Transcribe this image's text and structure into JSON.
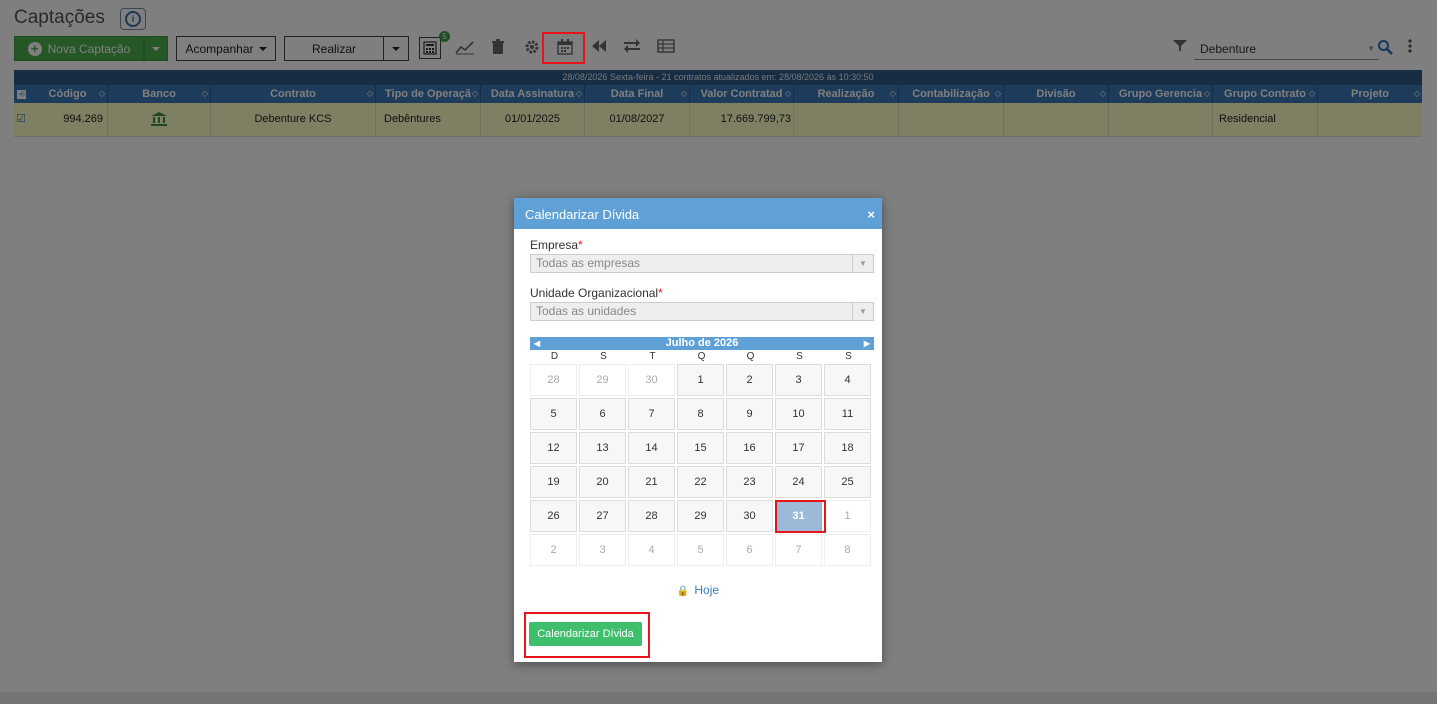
{
  "page": {
    "title": "Captações"
  },
  "toolbar": {
    "new_label": "Nova Captação",
    "follow_label": "Acompanhar",
    "realize_label": "Realizar",
    "calc_badge": "5",
    "filter_value": "Debenture"
  },
  "grid": {
    "status_line": "28/08/2026 Sexta-feira - 21 contratos atualizados em: 28/08/2026 às 10:30:50",
    "columns": [
      "Código",
      "Banco",
      "Contrato",
      "Tipo de Operaçã",
      "Data Assinatura",
      "Data Final",
      "Valor Contratad",
      "Realização",
      "Contabilização",
      "Divisão",
      "Grupo Gerencia",
      "Grupo Contrato",
      "Projeto"
    ],
    "row": {
      "codigo": "994.269",
      "contrato": "Debenture KCS",
      "tipo": "Debêntures",
      "assinatura": "01/01/2025",
      "final": "01/08/2027",
      "valor": "17.669.799,73",
      "grupo_contrato": "Residencial"
    }
  },
  "modal": {
    "title": "Calendarizar Dívida",
    "close": "×",
    "empresa_label": "Empresa",
    "empresa_value": "Todas as empresas",
    "unidade_label": "Unidade Organizacional",
    "unidade_value": "Todas as unidades",
    "required_mark": "*",
    "calendar": {
      "month_label": "Julho de 2026",
      "weekdays": [
        "D",
        "S",
        "T",
        "Q",
        "Q",
        "S",
        "S"
      ],
      "weeks": [
        [
          "28",
          "29",
          "30",
          "1",
          "2",
          "3",
          "4"
        ],
        [
          "5",
          "6",
          "7",
          "8",
          "9",
          "10",
          "11"
        ],
        [
          "12",
          "13",
          "14",
          "15",
          "16",
          "17",
          "18"
        ],
        [
          "19",
          "20",
          "21",
          "22",
          "23",
          "24",
          "25"
        ],
        [
          "26",
          "27",
          "28",
          "29",
          "30",
          "31",
          "1"
        ],
        [
          "2",
          "3",
          "4",
          "5",
          "6",
          "7",
          "8"
        ]
      ],
      "selected": "31"
    },
    "today_label": "Hoje",
    "submit_label": "Calendarizar Dívida"
  },
  "colors": {
    "accent_green": "#4cae4c",
    "header_blue": "#3b77b5",
    "modal_blue": "#5fa0d6",
    "highlight_red": "#e8141c",
    "row_yellow": "#ffffc7",
    "submit_green": "#3fbf6b"
  }
}
